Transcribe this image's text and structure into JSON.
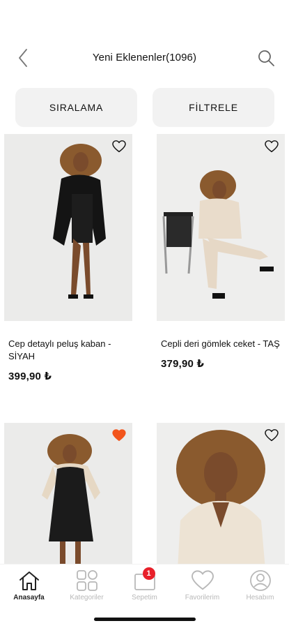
{
  "header": {
    "title": "Yeni Eklenenler(1096)",
    "back_icon": "chevron-left-icon",
    "search_icon": "search-icon"
  },
  "actions": {
    "sort_label": "SIRALAMA",
    "filter_label": "FİLTRELE"
  },
  "products": [
    {
      "name": "Cep detaylı peluş kaban - SİYAH",
      "price": "399,90 ₺",
      "favorited": false,
      "image": "woman-black-coat-photo"
    },
    {
      "name": "Cepli deri gömlek ceket - TAŞ",
      "price": "379,90 ₺",
      "favorited": false,
      "image": "woman-beige-leather-set-photo"
    },
    {
      "name": "",
      "price": "",
      "favorited": true,
      "image": "woman-black-leather-trench-photo"
    },
    {
      "name": "",
      "price": "",
      "favorited": false,
      "image": "woman-cream-sweater-photo"
    }
  ],
  "bottom_nav": {
    "items": [
      {
        "label": "Anasayfa",
        "icon": "home-icon",
        "active": true
      },
      {
        "label": "Kategoriler",
        "icon": "categories-grid-icon",
        "active": false
      },
      {
        "label": "Sepetim",
        "icon": "cart-icon",
        "active": false,
        "badge": "1"
      },
      {
        "label": "Favorilerim",
        "icon": "heart-icon",
        "active": false
      },
      {
        "label": "Hesabım",
        "icon": "user-icon",
        "active": false
      }
    ]
  },
  "colors": {
    "favorite_active": "#f2541b",
    "badge": "#e8202a",
    "button_bg": "#f2f2f2",
    "nav_inactive": "#b8b8b8"
  }
}
